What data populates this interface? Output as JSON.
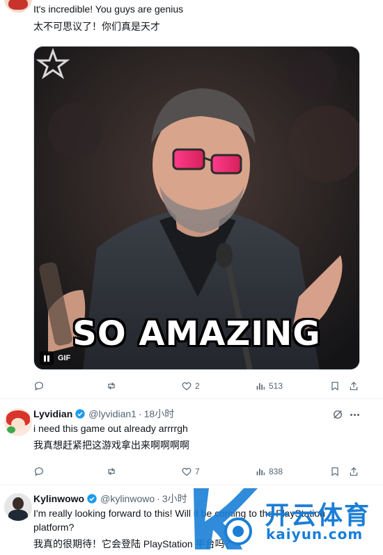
{
  "tweet_top": {
    "text_en": "It's incredible! You guys are genius",
    "text_zh": "太不可思议了！你们真是天才",
    "gif": {
      "caption": "SO AMAZING",
      "badge": "GIF",
      "pause_icon": "pause-icon"
    },
    "actions": {
      "reply_count": "",
      "retweet_count": "",
      "like_count": "2",
      "views_count": "513"
    }
  },
  "reply_lyvidian": {
    "name": "Lyvidian",
    "handle": "@lyvidian1",
    "separator": "·",
    "time": "18小时",
    "text_en": "i need this game out already arrrrgh",
    "text_zh": "我真想赶紧把这游戏拿出来啊啊啊啊",
    "actions": {
      "reply_count": "",
      "retweet_count": "",
      "like_count": "7",
      "views_count": "838"
    }
  },
  "reply_kylinwowo": {
    "name": "Kylinwowo",
    "handle": "@kylinwowo",
    "separator": "·",
    "time": "3小时",
    "text_en_line1": "I'm really looking forward to this! Will it be coming to the PlayStation",
    "text_en_line2": "platform?",
    "text_zh": "我真的很期待！它会登陆 PlayStation 平台吗？"
  },
  "watermark": {
    "brand": "开云体育",
    "url": "kaiyun.com"
  },
  "colors": {
    "text": "#0f1419",
    "muted": "#536471",
    "verified": "#1d9bf0",
    "divider": "#eff3f4",
    "watermark": "#1a7ed6"
  }
}
